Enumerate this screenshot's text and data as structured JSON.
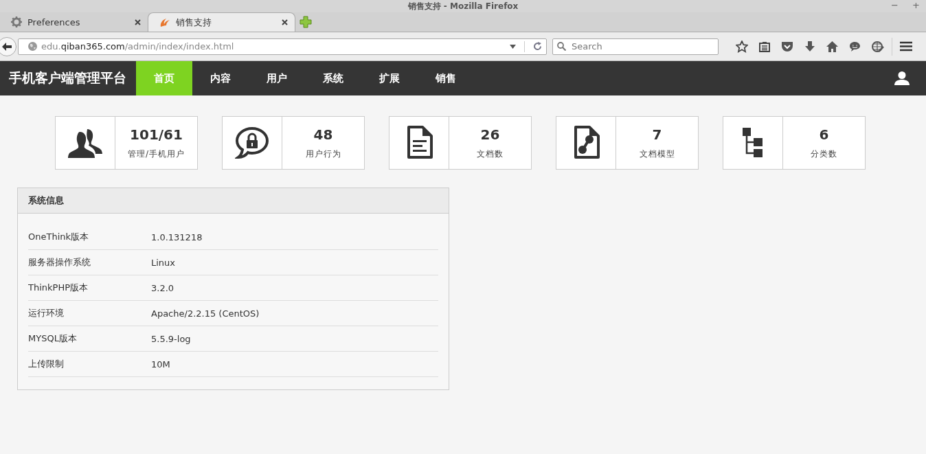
{
  "window": {
    "title": "销售支持 - Mozilla Firefox",
    "controls": [
      "−",
      "+"
    ]
  },
  "tabs": [
    {
      "label": "Preferences",
      "selected": false
    },
    {
      "label": "销售支持",
      "selected": true
    }
  ],
  "address_bar": {
    "host_prefix": "edu.",
    "host": "qiban365.com",
    "path": "/admin/index/index.html"
  },
  "search": {
    "placeholder": "Search"
  },
  "app": {
    "brand": "手机客户端管理平台",
    "nav": [
      {
        "label": "首页",
        "selected": true
      },
      {
        "label": "内容",
        "selected": false
      },
      {
        "label": "用户",
        "selected": false
      },
      {
        "label": "系统",
        "selected": false
      },
      {
        "label": "扩展",
        "selected": false
      },
      {
        "label": "销售",
        "selected": false
      }
    ]
  },
  "stats": [
    {
      "value": "101/61",
      "label": "管理/手机用户"
    },
    {
      "value": "48",
      "label": "用户行为"
    },
    {
      "value": "26",
      "label": "文档数"
    },
    {
      "value": "7",
      "label": "文档模型"
    },
    {
      "value": "6",
      "label": "分类数"
    }
  ],
  "system_info": {
    "title": "系统信息",
    "rows": [
      {
        "label": "OneThink版本",
        "value": "1.0.131218"
      },
      {
        "label": "服务器操作系统",
        "value": "Linux"
      },
      {
        "label": "ThinkPHP版本",
        "value": "3.2.0"
      },
      {
        "label": "运行环境",
        "value": "Apache/2.2.15 (CentOS)"
      },
      {
        "label": "MYSQL版本",
        "value": "5.5.9-log"
      },
      {
        "label": "上传限制",
        "value": "10M"
      }
    ]
  }
}
